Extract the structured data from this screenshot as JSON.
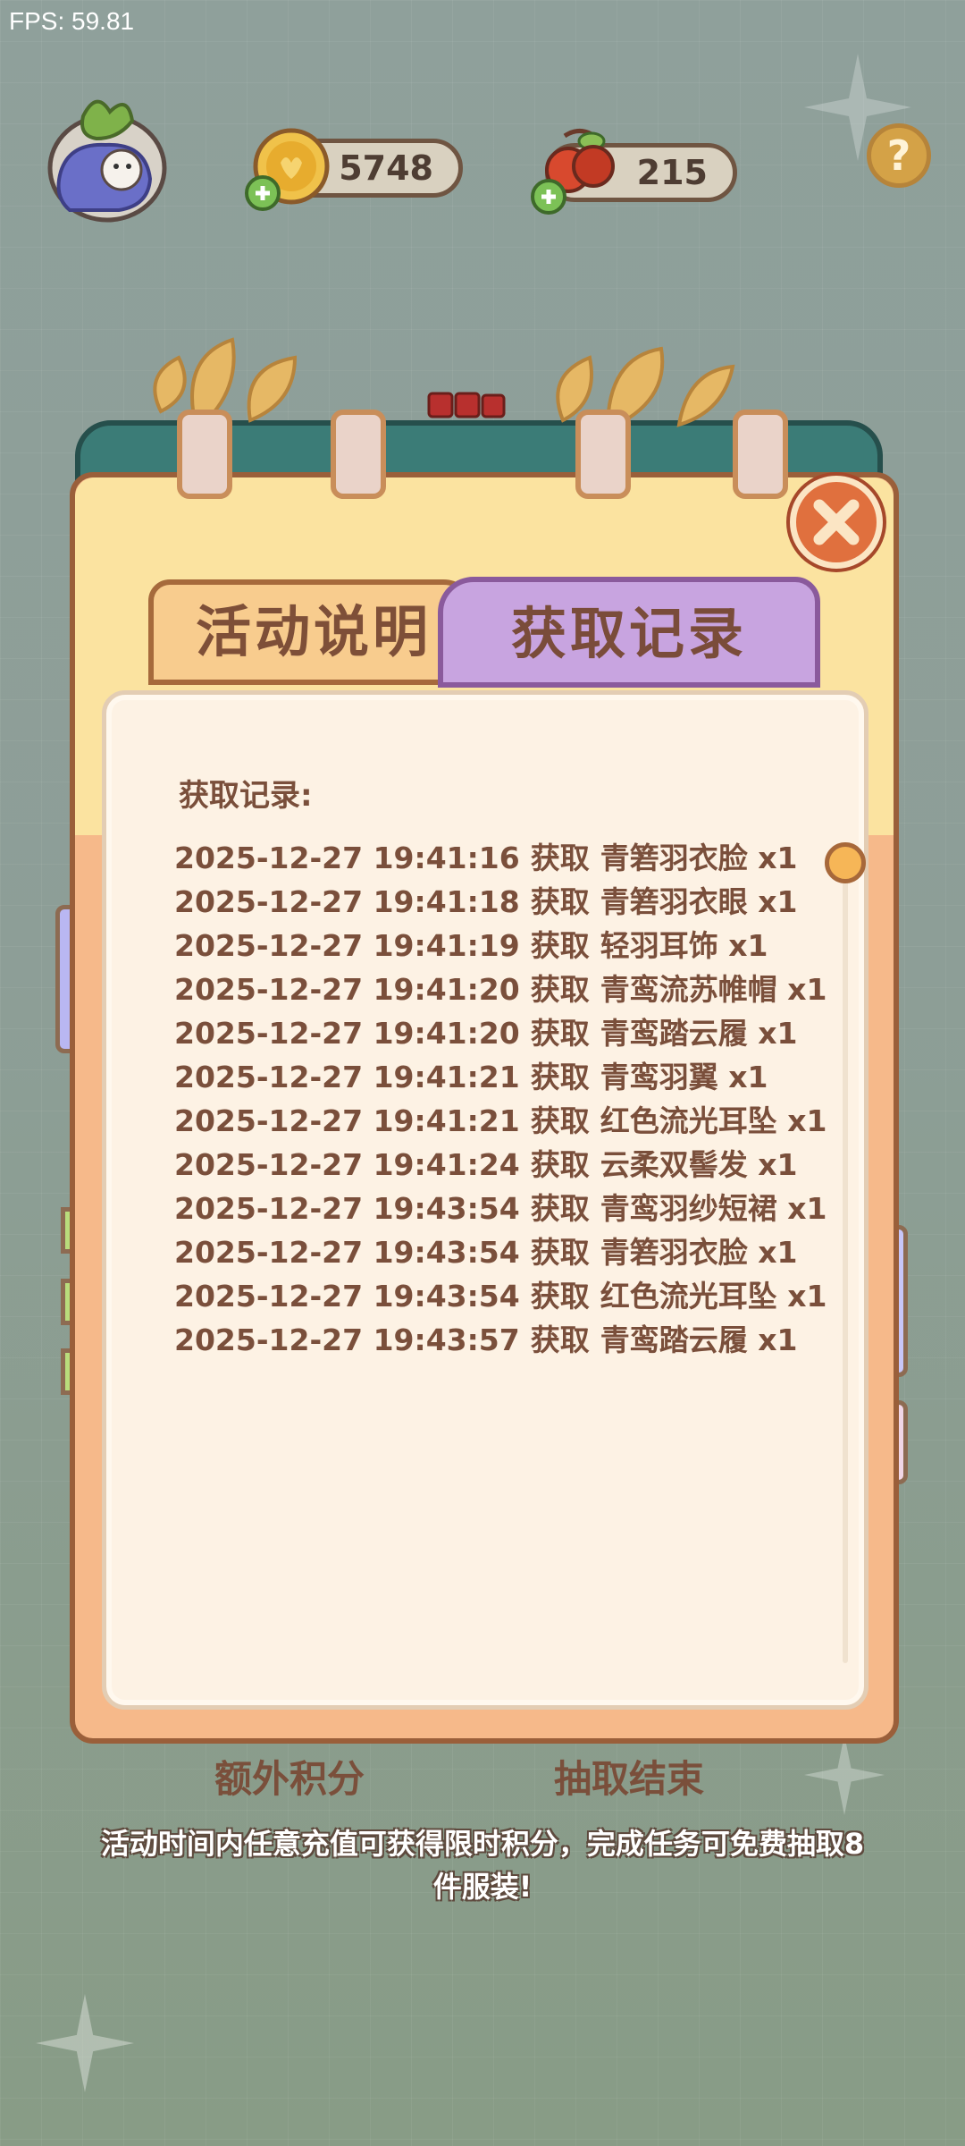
{
  "debug": {
    "fps": "FPS: 59.81"
  },
  "hud": {
    "coins": "5748",
    "cherries": "215",
    "help_symbol": "?"
  },
  "tabs": {
    "left_label": "活动说明",
    "right_label": "获取记录",
    "active": "获取记录"
  },
  "records_panel": {
    "title": "获取记录:",
    "entries": [
      {
        "time": "2025-12-27 19:41:16",
        "action": "获取",
        "item": "青箬羽衣脸 x1"
      },
      {
        "time": "2025-12-27 19:41:18",
        "action": "获取",
        "item": "青箬羽衣眼 x1"
      },
      {
        "time": "2025-12-27 19:41:19",
        "action": "获取",
        "item": "轻羽耳饰 x1"
      },
      {
        "time": "2025-12-27 19:41:20",
        "action": "获取",
        "item": "青鸾流苏帷帽 x1"
      },
      {
        "time": "2025-12-27 19:41:20",
        "action": "获取",
        "item": "青鸾踏云履 x1"
      },
      {
        "time": "2025-12-27 19:41:21",
        "action": "获取",
        "item": "青鸾羽翼 x1"
      },
      {
        "time": "2025-12-27 19:41:21",
        "action": "获取",
        "item": "红色流光耳坠 x1"
      },
      {
        "time": "2025-12-27 19:41:24",
        "action": "获取",
        "item": "云柔双髻发 x1"
      },
      {
        "time": "2025-12-27 19:43:54",
        "action": "获取",
        "item": "青鸾羽纱短裙 x1"
      },
      {
        "time": "2025-12-27 19:43:54",
        "action": "获取",
        "item": "青箬羽衣脸 x1"
      },
      {
        "time": "2025-12-27 19:43:54",
        "action": "获取",
        "item": "红色流光耳坠 x1"
      },
      {
        "time": "2025-12-27 19:43:57",
        "action": "获取",
        "item": "青鸾踏云履 x1"
      }
    ]
  },
  "bottom": {
    "extra_points": "额外积分",
    "draw_end": "抽取结束",
    "description": "活动时间内任意充值可获得限时积分，完成任务可免费抽取8件服装!"
  },
  "colors": {
    "background": "#8fa09b",
    "panel_orange": "#f6b98a",
    "tab_purple": "#c8a4e0",
    "text_brown": "#7a4f3b",
    "close_red": "#e0703e"
  },
  "icons": [
    "avatar-icon",
    "coin-icon",
    "cherry-icon",
    "plus-icon",
    "help-icon",
    "close-icon"
  ]
}
